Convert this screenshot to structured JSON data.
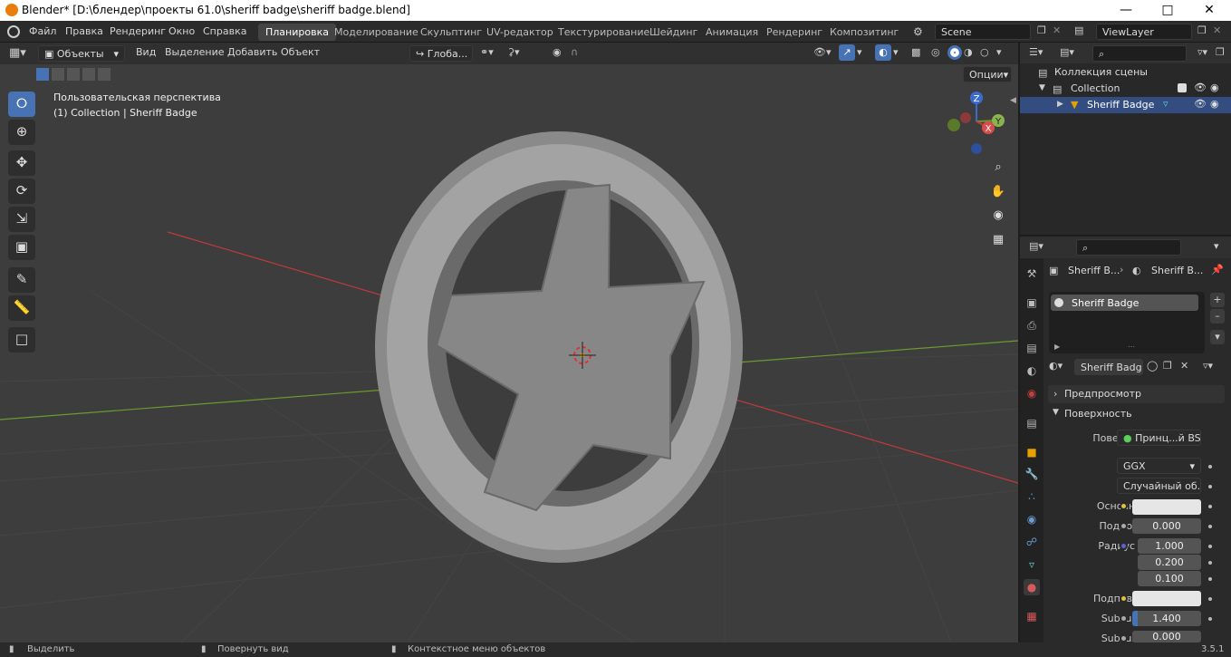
{
  "titlebar": {
    "title": "Blender* [D:\\блендер\\проекты 61.0\\sheriff badge\\sheriff badge.blend]"
  },
  "menu": [
    "Файл",
    "Правка",
    "Рендеринг",
    "Окно",
    "Справка"
  ],
  "workspaces": [
    "Планировка",
    "Моделирование",
    "Скульптинг",
    "UV-редактор",
    "Текстурирование",
    "Шейдинг",
    "Анимация",
    "Рендеринг",
    "Композитинг"
  ],
  "scene": "Scene",
  "view_layer": "ViewLayer",
  "viewport_header": {
    "mode": "Объекты",
    "view": "Вид",
    "select": "Выделение",
    "add": "Добавить",
    "object": "Объект",
    "orientation": "Глоба...",
    "options": "Опции"
  },
  "viewport": {
    "perspective": "Пользовательская перспектива",
    "collection_info": "(1) Collection | Sheriff Badge"
  },
  "gizmo": {
    "z": "Z",
    "y": "Y",
    "x": "X"
  },
  "outliner": {
    "scene_collection": "Коллекция сцены",
    "collection": "Collection",
    "object": "Sheriff Badge"
  },
  "properties": {
    "breadcrumb_object": "Sheriff B...",
    "breadcrumb_material": "Sheriff B...",
    "material_slot": "Sheriff Badge",
    "material_name": "Sheriff Badge",
    "preview_panel": "Предпросмотр",
    "surface_panel": "Поверхность",
    "surface_label": "Поверхность",
    "surface_value": "Принц...й BSDF",
    "distribution": "GGX",
    "subsurface_method": "Случайный об...",
    "base_color_label": "Основной ...",
    "subsurface_label": "Подпов. р...",
    "subsurface_value": "0.000",
    "radius_label": "Радиус по...",
    "radius": [
      "1.000",
      "0.200",
      "0.100"
    ],
    "sub_color_label": "Подпов. цв...",
    "sub_ior_label": "Subsurfac...",
    "sub_ior_value": "1.400",
    "sub_aniso_label": "Subsurfac...",
    "sub_aniso_value": "0.000"
  },
  "status": {
    "select": "Выделить",
    "rotate": "Повернуть вид",
    "context": "Контекстное меню объектов",
    "version": "3.5.1"
  },
  "colors": {
    "accent": "#4772b3",
    "title_bg": "#ffffff",
    "viewport_bg": "#3d3d3d",
    "x_axis": "#c03a3a",
    "y_axis": "#6b9a2f"
  }
}
